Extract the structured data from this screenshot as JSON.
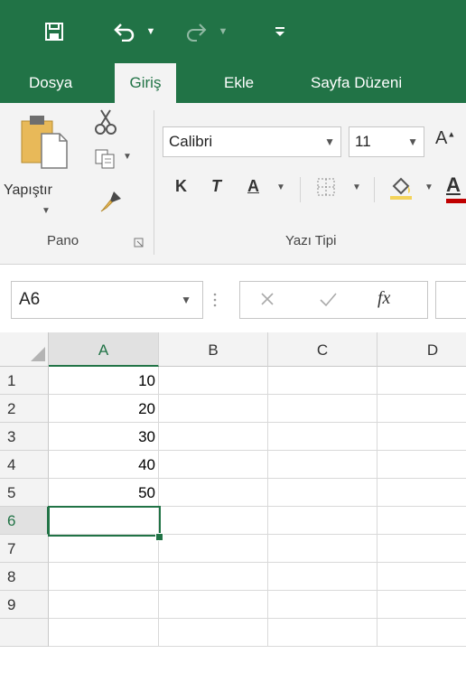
{
  "quick_access": {
    "save_icon": "save-icon",
    "undo_icon": "undo-icon",
    "redo_icon": "redo-icon",
    "customize_icon": "customize-qat-icon"
  },
  "tabs": [
    {
      "label": "Dosya",
      "active": false
    },
    {
      "label": "Giriş",
      "active": true
    },
    {
      "label": "Ekle",
      "active": false
    },
    {
      "label": "Sayfa Düzeni",
      "active": false
    }
  ],
  "ribbon": {
    "clipboard": {
      "paste_label": "Yapıştır",
      "group_label": "Pano"
    },
    "font": {
      "font_name": "Calibri",
      "font_size": "11",
      "bold": "K",
      "italic": "T",
      "underline": "A",
      "group_label": "Yazı Tipi"
    }
  },
  "formula_bar": {
    "name_box": "A6",
    "fx": "fx",
    "value": ""
  },
  "sheet": {
    "columns": [
      "A",
      "B",
      "C",
      "D"
    ],
    "rows": [
      "1",
      "2",
      "3",
      "4",
      "5",
      "6",
      "7",
      "8",
      "9"
    ],
    "values_col_a": [
      "10",
      "20",
      "30",
      "40",
      "50",
      "",
      "",
      "",
      ""
    ],
    "selected_cell": "A6"
  },
  "colors": {
    "accent": "#217346",
    "ribbon_bg": "#f3f3f3",
    "font_color_red": "#c00000"
  }
}
